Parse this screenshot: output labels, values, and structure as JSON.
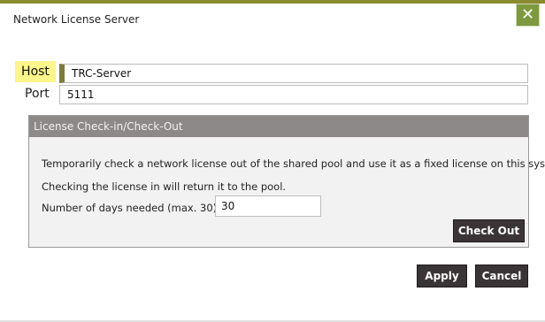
{
  "dialog": {
    "title": "Network License Server"
  },
  "close_button": {
    "glyph": "✕",
    "icon": "close-icon"
  },
  "host": {
    "label": "Host",
    "value": "TRC-Server"
  },
  "port": {
    "label": "Port",
    "value": "5111"
  },
  "license_group": {
    "title": "License Check-in/Check-Out",
    "description_1": "Temporarily check a network license out of the shared pool and use it as a fixed license on this system.",
    "description_2": "Checking the license in will return it to the pool.",
    "days_label": "Number of days needed (max. 30)",
    "days_value": "30",
    "checkout_label": "Check Out"
  },
  "footer": {
    "apply_label": "Apply",
    "cancel_label": "Cancel"
  },
  "colors": {
    "accent": "#7d9a3e",
    "host_highlight": "#fbf58a",
    "group_header": "#8e8989",
    "button_dark": "#3a3437"
  }
}
